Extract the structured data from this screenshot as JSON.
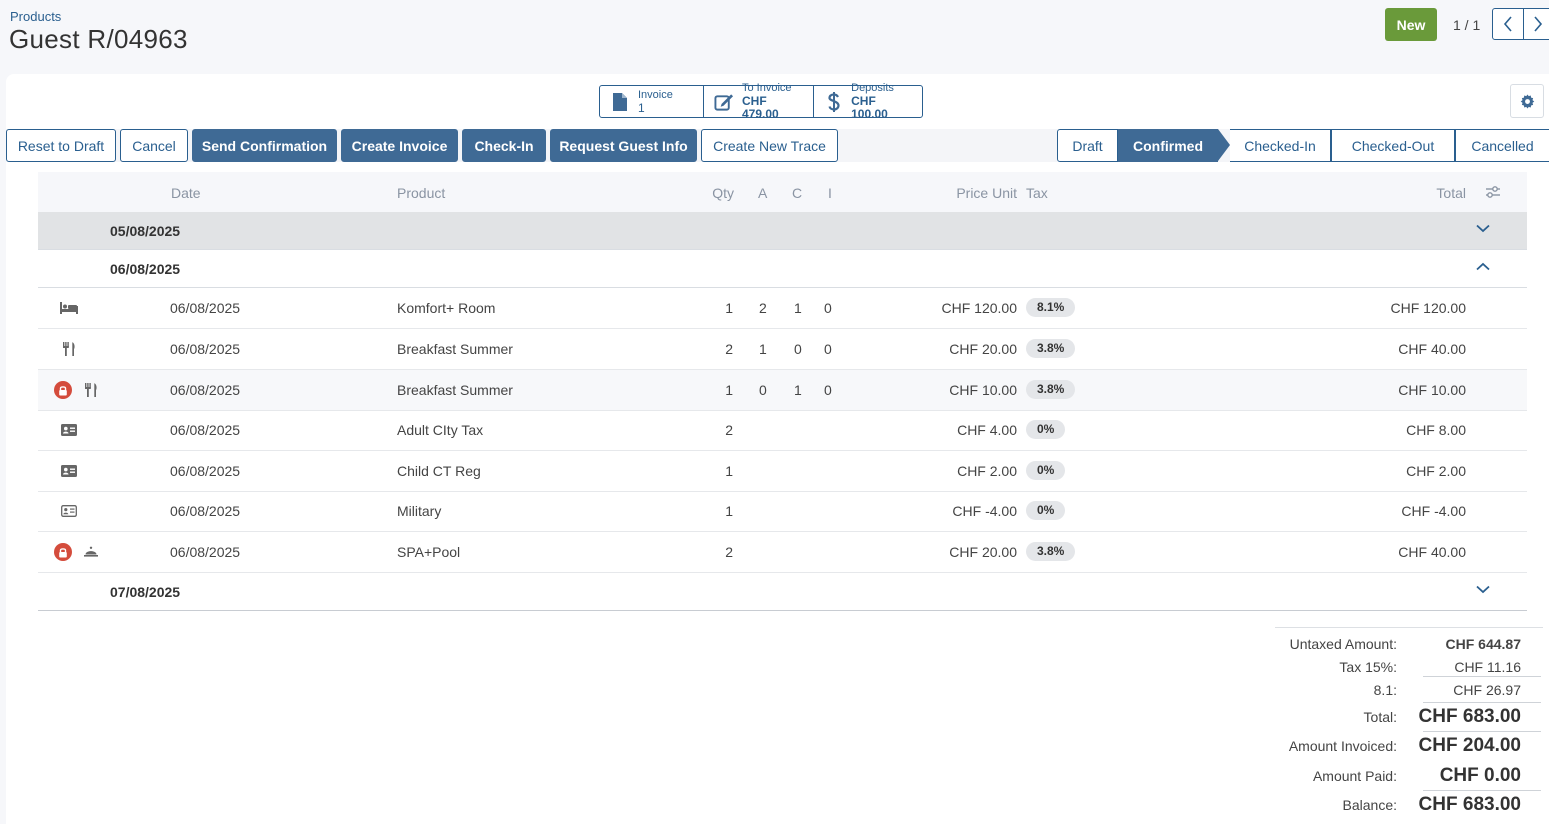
{
  "header": {
    "breadcrumb": "Products",
    "title": "Guest R/04963",
    "new_label": "New",
    "pager": "1 / 1"
  },
  "smart_buttons": [
    {
      "label": "Invoice",
      "value": "1"
    },
    {
      "label": "To Invoice",
      "value": "CHF 479.00"
    },
    {
      "label": "Deposits",
      "value": "CHF 100.00"
    }
  ],
  "actions": {
    "reset": "Reset to Draft",
    "cancel": "Cancel",
    "send_confirmation": "Send Confirmation",
    "create_invoice": "Create Invoice",
    "check_in": "Check-In",
    "request_guest_info": "Request Guest Info",
    "create_trace": "Create New Trace"
  },
  "states": [
    "Draft",
    "Confirmed",
    "Checked-In",
    "Checked-Out",
    "Cancelled"
  ],
  "active_state": "Confirmed",
  "table": {
    "headers": {
      "date": "Date",
      "product": "Product",
      "qty": "Qty",
      "a": "A",
      "c": "C",
      "i": "I",
      "price": "Price Unit",
      "tax": "Tax",
      "total": "Total"
    },
    "groups": [
      "05/08/2025",
      "06/08/2025",
      "07/08/2025"
    ],
    "rows": [
      {
        "icon": "bed-icon",
        "locked": false,
        "date": "06/08/2025",
        "product": "Komfort+ Room",
        "qty": "1",
        "a": "2",
        "c": "1",
        "i": "0",
        "price": "CHF 120.00",
        "tax": "8.1%",
        "total": "CHF 120.00"
      },
      {
        "icon": "utensils-icon",
        "locked": false,
        "date": "06/08/2025",
        "product": "Breakfast Summer",
        "qty": "2",
        "a": "1",
        "c": "0",
        "i": "0",
        "price": "CHF 20.00",
        "tax": "3.8%",
        "total": "CHF 40.00"
      },
      {
        "icon": "utensils-icon",
        "locked": true,
        "date": "06/08/2025",
        "product": "Breakfast Summer",
        "qty": "1",
        "a": "0",
        "c": "1",
        "i": "0",
        "price": "CHF 10.00",
        "tax": "3.8%",
        "total": "CHF 10.00"
      },
      {
        "icon": "id-card-icon",
        "locked": false,
        "date": "06/08/2025",
        "product": "Adult CIty Tax",
        "qty": "2",
        "a": "",
        "c": "",
        "i": "",
        "price": "CHF 4.00",
        "tax": "0%",
        "total": "CHF 8.00"
      },
      {
        "icon": "id-card-icon",
        "locked": false,
        "date": "06/08/2025",
        "product": "Child CT Reg",
        "qty": "1",
        "a": "",
        "c": "",
        "i": "",
        "price": "CHF 2.00",
        "tax": "0%",
        "total": "CHF 2.00"
      },
      {
        "icon": "id-card-outline-icon",
        "locked": false,
        "date": "06/08/2025",
        "product": "Military",
        "qty": "1",
        "a": "",
        "c": "",
        "i": "",
        "price": "CHF -4.00",
        "tax": "0%",
        "total": "CHF -4.00"
      },
      {
        "icon": "cloche-icon",
        "locked": true,
        "date": "06/08/2025",
        "product": "SPA+Pool",
        "qty": "2",
        "a": "",
        "c": "",
        "i": "",
        "price": "CHF 20.00",
        "tax": "3.8%",
        "total": "CHF 40.00"
      }
    ]
  },
  "totals": {
    "untaxed_label": "Untaxed Amount:",
    "untaxed": "CHF 644.87",
    "tax15_label": "Tax 15%:",
    "tax15": "CHF 11.16",
    "tax81_label": "8.1:",
    "tax81": "CHF 26.97",
    "total_label": "Total:",
    "total": "CHF 683.00",
    "invoiced_label": "Amount Invoiced:",
    "invoiced": "CHF 204.00",
    "paid_label": "Amount Paid:",
    "paid": "CHF 0.00",
    "balance_label": "Balance:",
    "balance": "CHF 683.00"
  },
  "colors": {
    "primary": "#3f6a95",
    "success": "#6a9a3a",
    "danger": "#d44c3c"
  }
}
